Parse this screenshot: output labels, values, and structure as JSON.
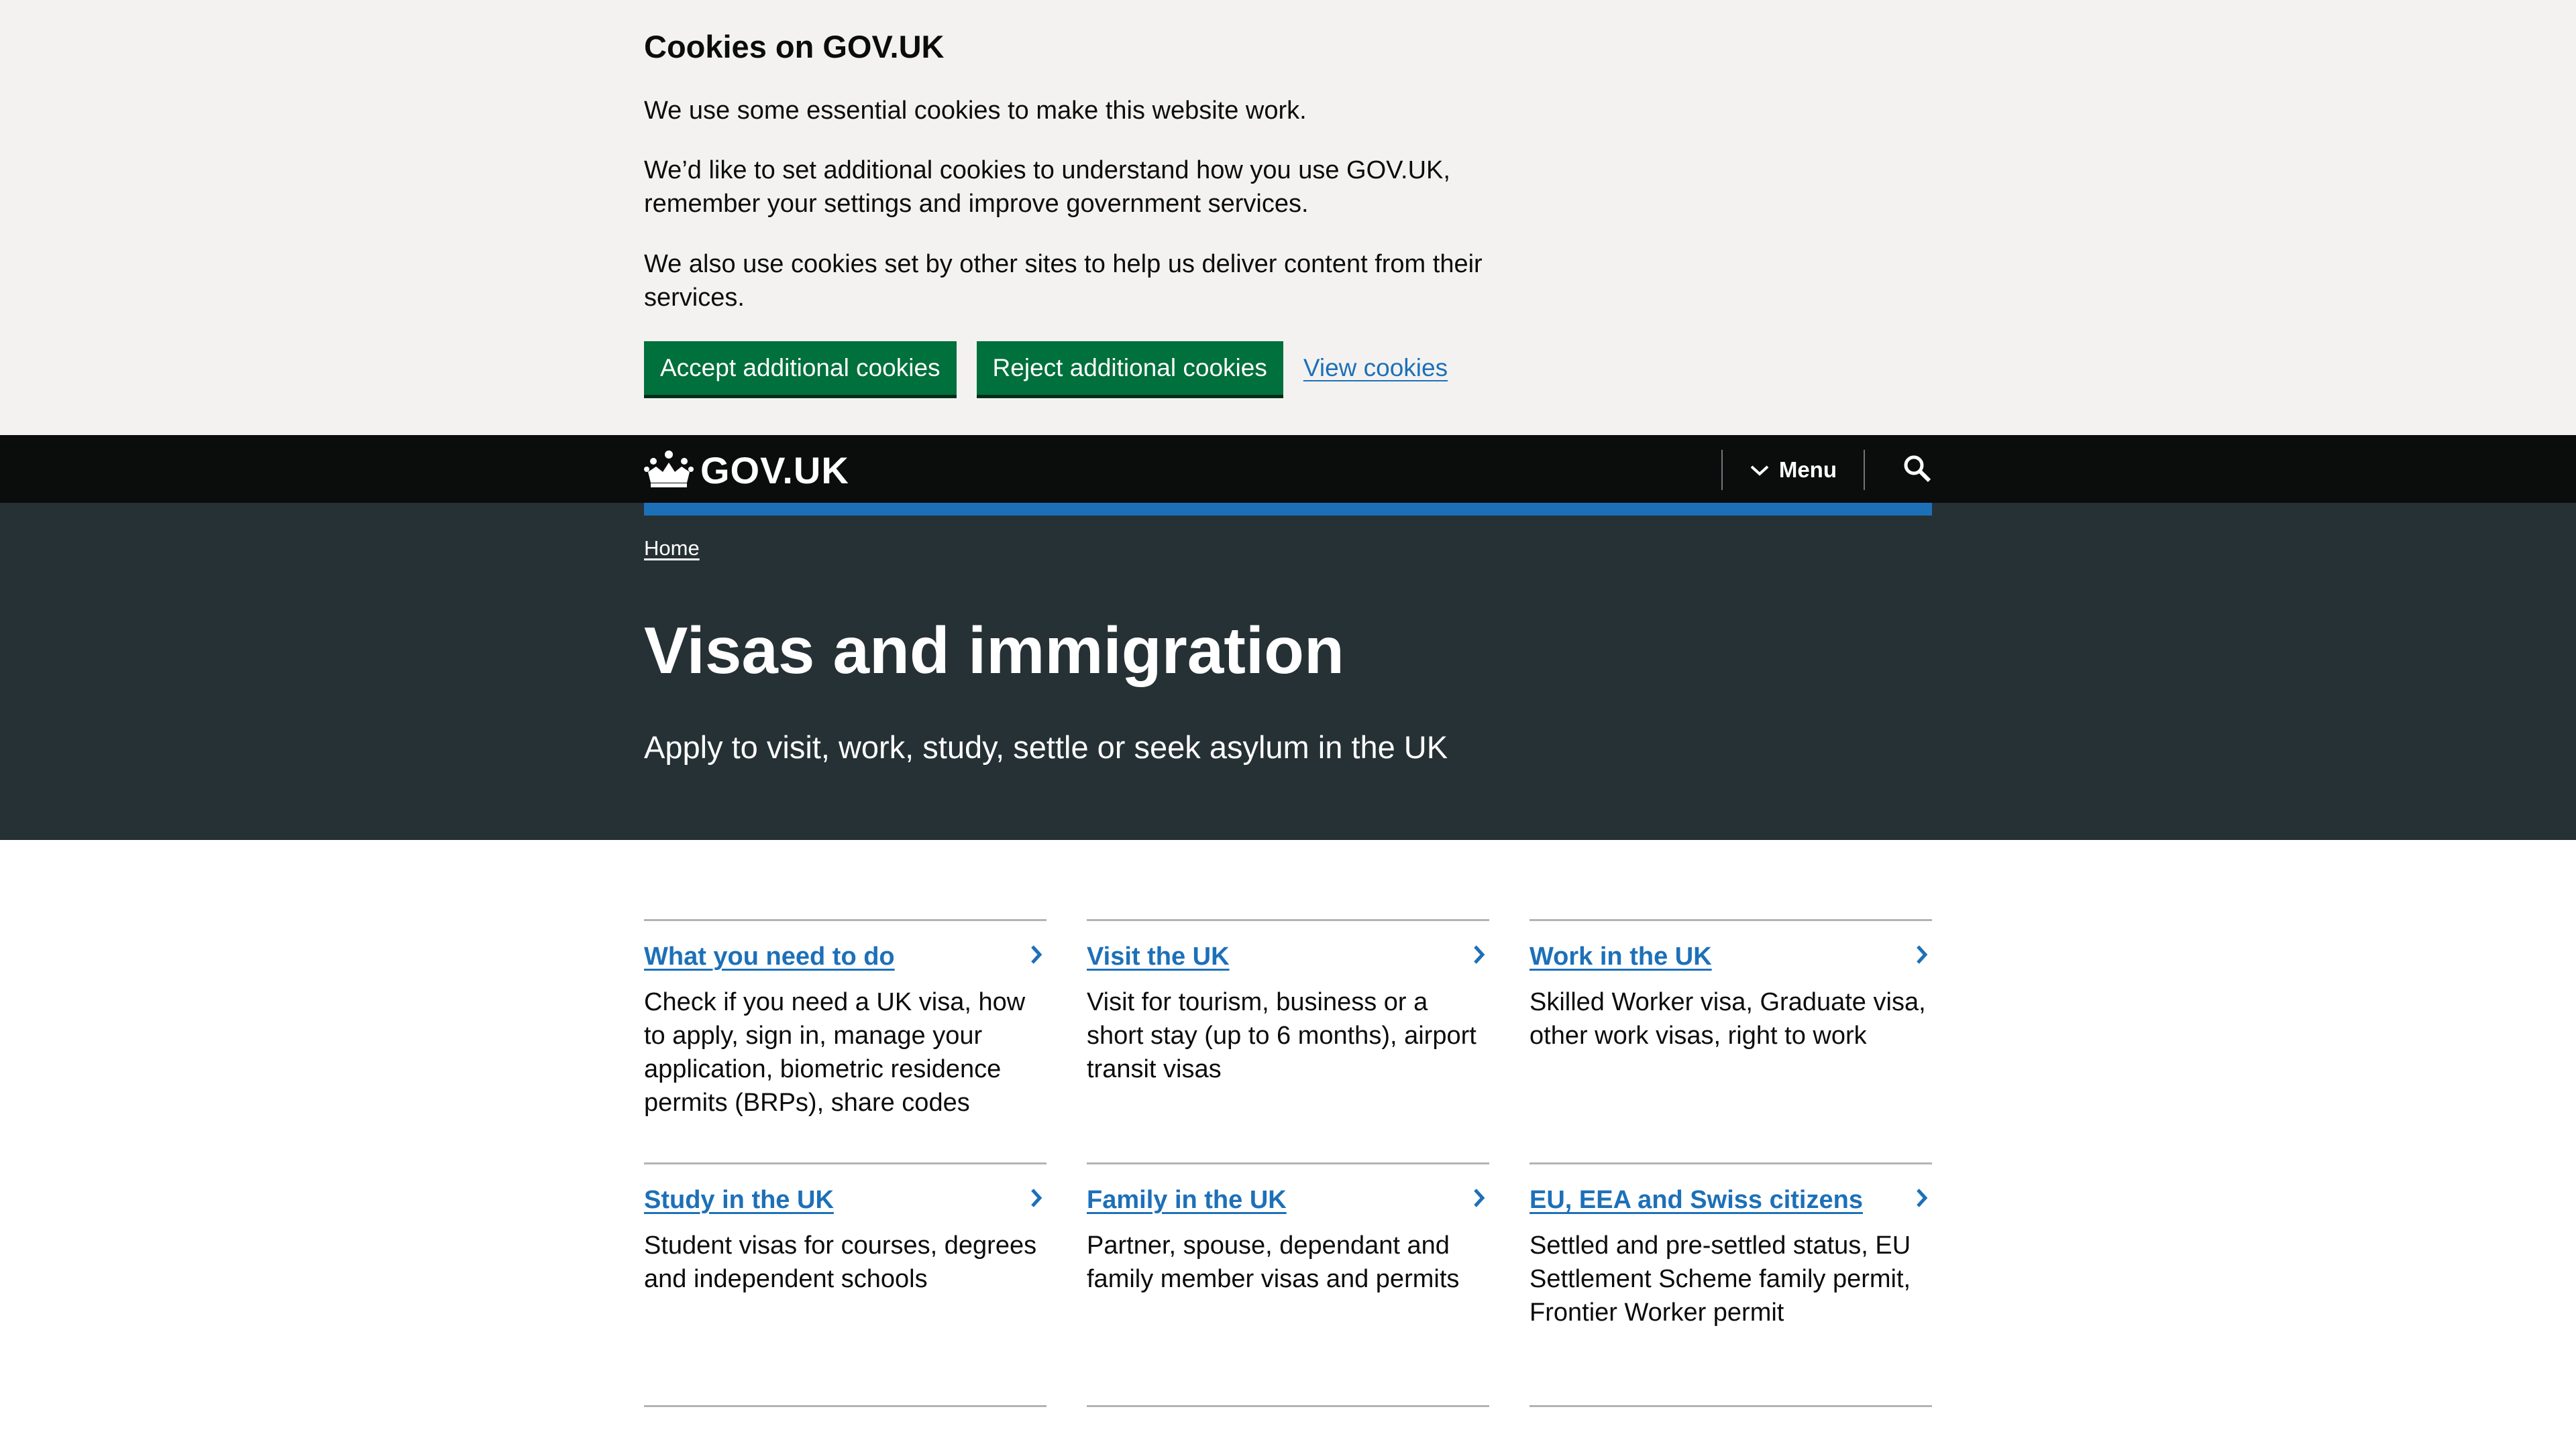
{
  "cookie_banner": {
    "title": "Cookies on GOV.UK",
    "p1": "We use some essential cookies to make this website work.",
    "p2": "We’d like to set additional cookies to understand how you use GOV.UK, remember your settings and improve government services.",
    "p3": "We also use cookies set by other sites to help us deliver content from their services.",
    "accept_label": "Accept additional cookies",
    "reject_label": "Reject additional cookies",
    "view_label": "View cookies"
  },
  "header": {
    "logo_text": "GOV.UK",
    "menu_label": "Menu"
  },
  "hero": {
    "breadcrumb": "Home",
    "title": "Visas and immigration",
    "subtitle": "Apply to visit, work, study, settle or seek asylum in the UK"
  },
  "topics": [
    {
      "title": "What you need to do",
      "desc": "Check if you need a UK visa, how to apply, sign in, manage your application, biometric residence permits (BRPs), share codes"
    },
    {
      "title": "Visit the UK",
      "desc": "Visit for tourism, business or a short stay (up to 6 months), airport transit visas"
    },
    {
      "title": "Work in the UK",
      "desc": "Skilled Worker visa, Graduate visa, other work visas, right to work"
    },
    {
      "title": "Study in the UK",
      "desc": "Student visas for courses, degrees and independent schools"
    },
    {
      "title": "Family in the UK",
      "desc": "Partner, spouse, dependant and family member visas and permits"
    },
    {
      "title": "EU, EEA and Swiss citizens",
      "desc": "Settled and pre-settled status, EU Settlement Scheme family permit, Frontier Worker permit"
    }
  ],
  "colors": {
    "banner_bg": "#f3f2f1",
    "header_bg": "#0b0c0c",
    "hero_bg": "#263135",
    "accent_blue": "#1d70b8",
    "button_green": "#00703c"
  }
}
